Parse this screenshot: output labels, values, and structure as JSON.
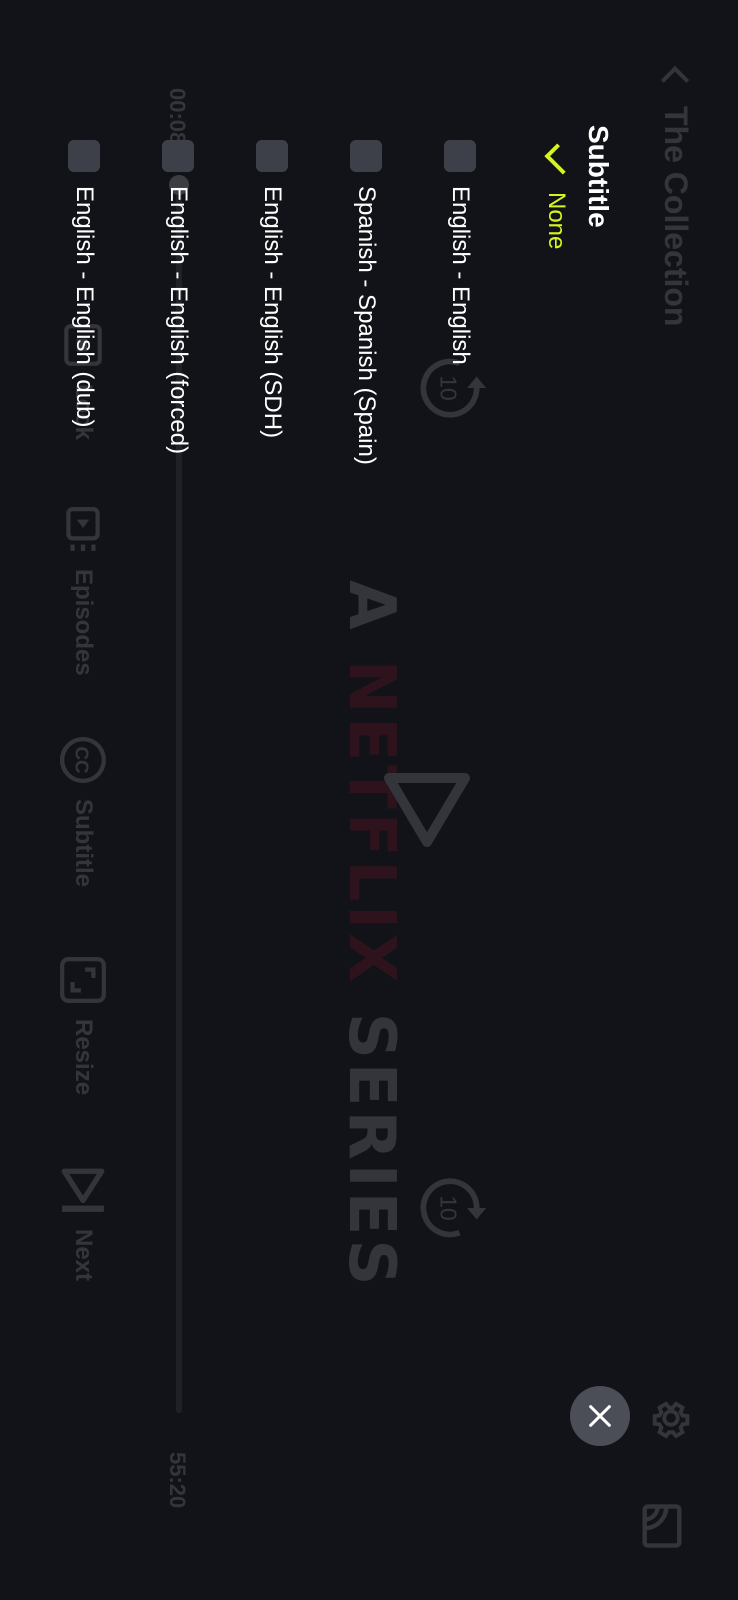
{
  "player": {
    "title": "The Collection",
    "current_time": "00:08",
    "total_time": "55:20",
    "progress": 0.002,
    "logo_prefix": "A ",
    "logo_brand": "NETFLIX",
    "logo_suffix": " SERIES",
    "skip_seconds": "10",
    "controls": {
      "lock": "Lock",
      "episodes": "Episodes",
      "subtitle": "Subtitle",
      "resize": "Resize",
      "next": "Next"
    }
  },
  "subtitle_panel": {
    "title": "Subtitle",
    "selected_option": "None",
    "options": [
      {
        "label": "None",
        "selected": true
      },
      {
        "label": "English - English",
        "selected": false
      },
      {
        "label": "Spanish - Spanish (Spain)",
        "selected": false
      },
      {
        "label": "English - English (SDH)",
        "selected": false
      },
      {
        "label": "English - English (forced)",
        "selected": false
      },
      {
        "label": "English - English (dub)",
        "selected": false
      }
    ]
  },
  "colors": {
    "accent": "#d6f51f",
    "background": "#121318",
    "brand_red": "#b0112a"
  },
  "icons": [
    "back-icon",
    "gear-icon",
    "cast-icon",
    "rewind-10-icon",
    "play-icon",
    "forward-10-icon",
    "lock-icon",
    "episodes-icon",
    "subtitle-icon",
    "resize-icon",
    "next-icon",
    "check-icon",
    "close-icon"
  ]
}
